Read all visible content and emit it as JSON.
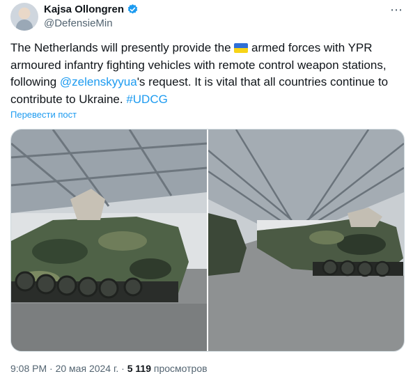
{
  "author": {
    "name": "Kajsa Ollongren",
    "handle": "@DefensieMin"
  },
  "icons": {
    "verified": "verified-badge-icon",
    "more": "more-options-icon",
    "flag": "ukraine-flag-icon"
  },
  "tweet": {
    "part1": "The Netherlands will presently provide the ",
    "part2": " armed forces with YPR armoured infantry fighting vehicles with remote control weapon stations, following ",
    "mention": "@zelenskyyua",
    "part3": "'s request. It is vital that all countries continue to contribute to Ukraine. ",
    "hashtag": "#UDCG"
  },
  "translate_label": "Перевести пост",
  "meta": {
    "time": "9:08 PM",
    "separator": "·",
    "date": "20 мая 2024 г.",
    "views_count": "5 119",
    "views_label": "просмотров"
  },
  "colors": {
    "link": "#1d9bf0",
    "verified": "#1d9bf0",
    "secondary_text": "#536471"
  }
}
